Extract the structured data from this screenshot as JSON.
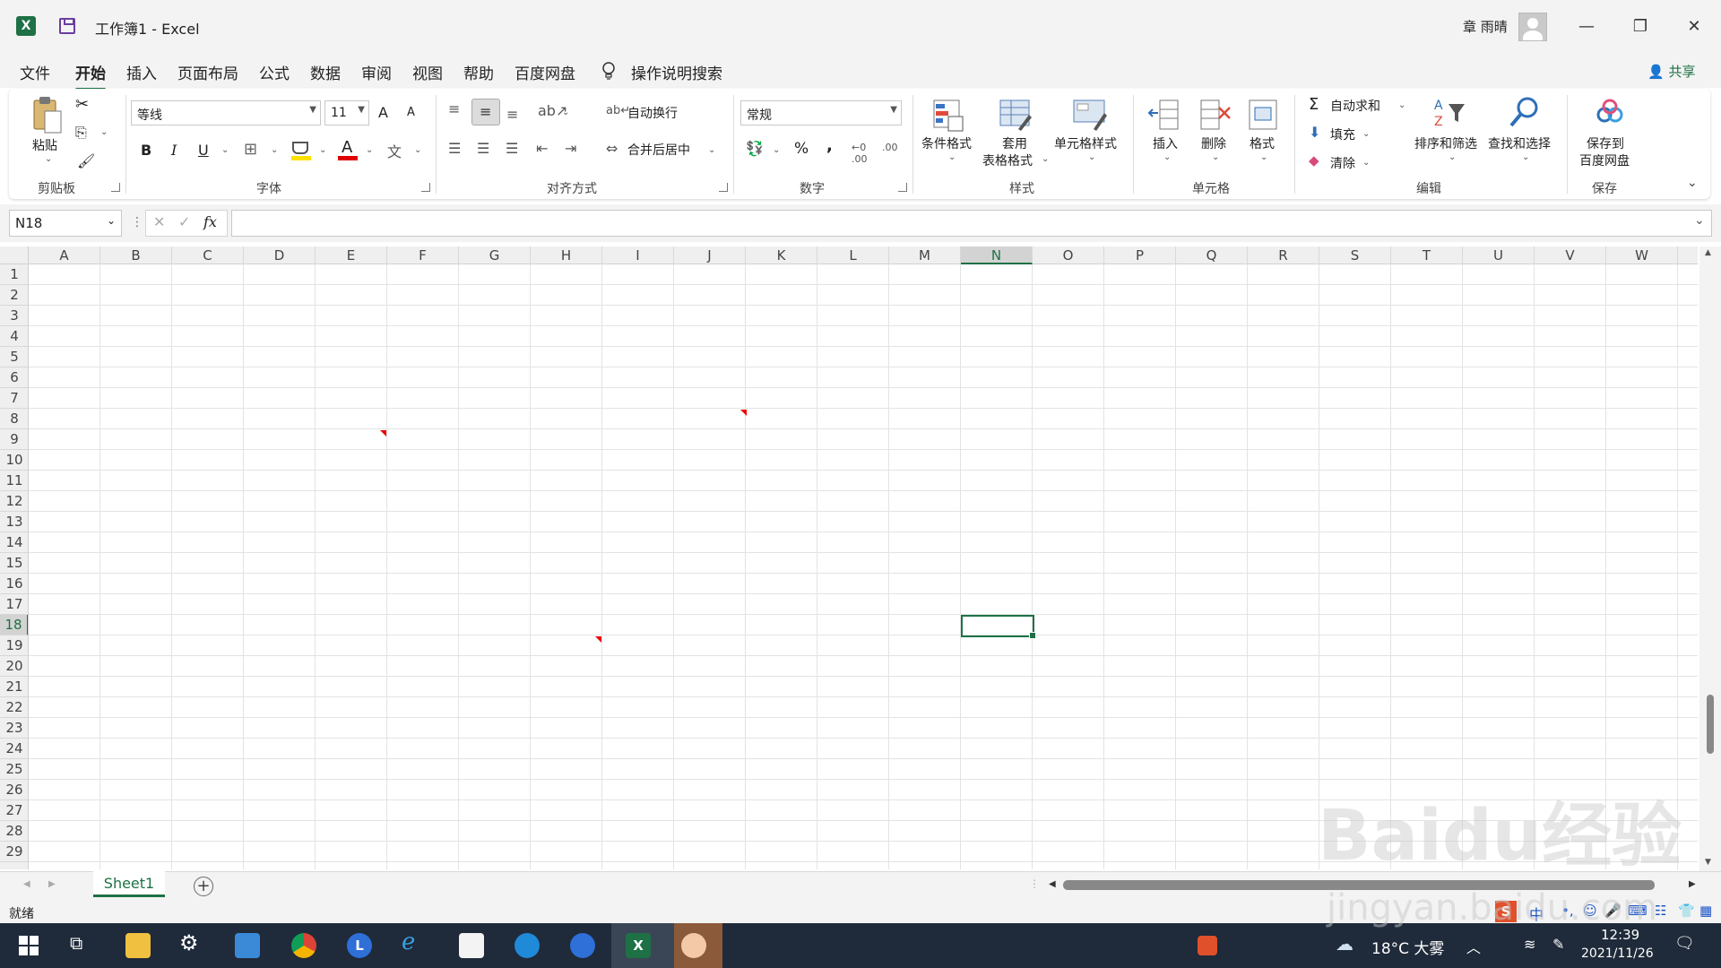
{
  "window": {
    "title": "工作簿1  -  Excel",
    "user": "章 雨晴",
    "controls": [
      "—",
      "❐",
      "✕"
    ]
  },
  "tabs": [
    "文件",
    "开始",
    "插入",
    "页面布局",
    "公式",
    "数据",
    "审阅",
    "视图",
    "帮助",
    "百度网盘"
  ],
  "active_tab": "开始",
  "search_hint": "操作说明搜索",
  "share_label": "共享",
  "ribbon": {
    "clipboard": {
      "paste": "粘贴",
      "group": "剪贴板"
    },
    "font": {
      "font_name": "等线",
      "font_size": "11",
      "grow": "A",
      "shrink": "A",
      "bold": "B",
      "italic": "I",
      "underline": "U",
      "color_letter": "A",
      "phonetic": "文",
      "group": "字体"
    },
    "alignment": {
      "wrap": "自动换行",
      "merge": "合并后居中",
      "group": "对齐方式"
    },
    "number": {
      "format": "常规",
      "percent": "%",
      "comma": ",",
      "inc_dec": ".00",
      "group": "数字"
    },
    "styles": {
      "conditional": "条件格式",
      "table_1": "套用",
      "table_2": "表格格式",
      "cell_styles": "单元格样式",
      "group": "样式"
    },
    "cells": {
      "insert": "插入",
      "delete": "删除",
      "format": "格式",
      "group": "单元格"
    },
    "editing": {
      "autosum": "自动求和",
      "fill": "填充",
      "clear": "清除",
      "sort": "排序和筛选",
      "find": "查找和选择",
      "group": "编辑"
    },
    "save": {
      "label_1": "保存到",
      "label_2": "百度网盘",
      "group": "保存"
    }
  },
  "formula_bar": {
    "name_box": "N18",
    "fx": "fx",
    "value": ""
  },
  "columns": [
    "A",
    "B",
    "C",
    "D",
    "E",
    "F",
    "G",
    "H",
    "I",
    "J",
    "K",
    "L",
    "M",
    "N",
    "O",
    "P",
    "Q",
    "R",
    "S",
    "T",
    "U",
    "V",
    "W"
  ],
  "rows": [
    "1",
    "2",
    "3",
    "4",
    "5",
    "6",
    "7",
    "8",
    "9",
    "10",
    "11",
    "12",
    "13",
    "14",
    "15",
    "16",
    "17",
    "18",
    "19",
    "20",
    "21",
    "22",
    "23",
    "24",
    "25",
    "26",
    "27",
    "28",
    "29"
  ],
  "selected": {
    "column": "N",
    "row": "18"
  },
  "sheet_tab": "Sheet1",
  "add_sheet": "+",
  "status": "就绪",
  "taskbar": {
    "weather": "18°C 大雾",
    "time": "12:39",
    "date": "2021/11/26",
    "ime": "中"
  },
  "watermark": {
    "brand": "Baidu经验",
    "url": "jingyan.baidu.com"
  },
  "colors": {
    "excel_green": "#1e7145",
    "taskbar": "#1f2a3a"
  }
}
